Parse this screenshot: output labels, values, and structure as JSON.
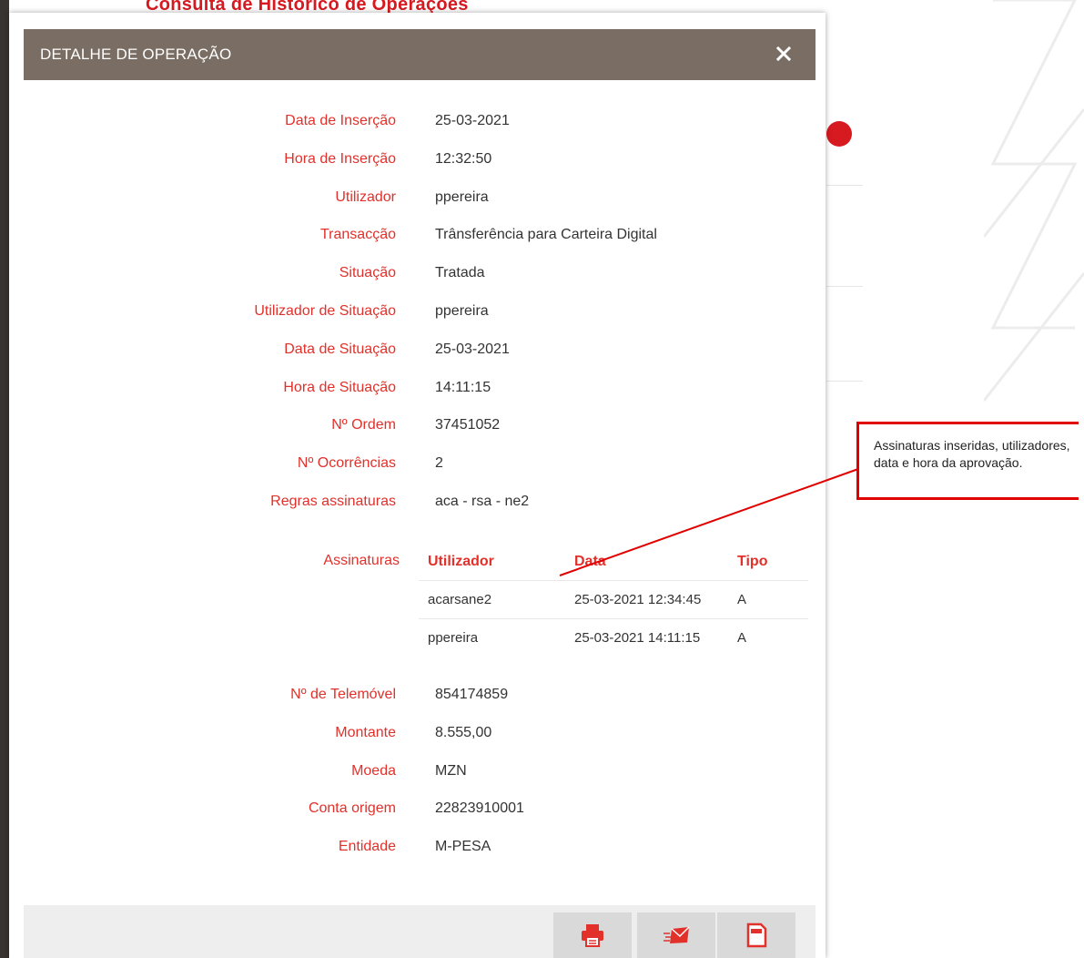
{
  "background": {
    "title": "Consulta de Histórico de Operações",
    "accent": "#d71920"
  },
  "modal": {
    "title": "DETALHE DE OPERAÇÃO",
    "close_icon": "close-icon"
  },
  "fields": [
    {
      "label": "Data de Inserção",
      "value": "25-03-2021"
    },
    {
      "label": "Hora de Inserção",
      "value": "12:32:50"
    },
    {
      "label": "Utilizador",
      "value": "ppereira"
    },
    {
      "label": "Transacção",
      "value": "Trânsferência para Carteira Digital"
    },
    {
      "label": "Situação",
      "value": "Tratada"
    },
    {
      "label": "Utilizador de Situação",
      "value": "ppereira"
    },
    {
      "label": "Data de Situação",
      "value": "25-03-2021"
    },
    {
      "label": "Hora de Situação",
      "value": "14:11:15"
    },
    {
      "label": "Nº Ordem",
      "value": "37451052"
    },
    {
      "label": "Nº Ocorrências",
      "value": "2"
    },
    {
      "label": "Regras assinaturas",
      "value": "aca - rsa - ne2"
    }
  ],
  "signatures": {
    "label": "Assinaturas",
    "headers": [
      "Utilizador",
      "Data",
      "Tipo"
    ],
    "rows": [
      [
        "acarsane2",
        "25-03-2021 12:34:45",
        "A"
      ],
      [
        "ppereira",
        "25-03-2021 14:11:15",
        "A"
      ]
    ]
  },
  "fields2": [
    {
      "label": "Nº de Telemóvel",
      "value": "854174859"
    },
    {
      "label": "Montante",
      "value": "8.555,00"
    },
    {
      "label": "Moeda",
      "value": "MZN"
    },
    {
      "label": "Conta origem",
      "value": "22823910001"
    },
    {
      "label": "Entidade",
      "value": "M-PESA"
    }
  ],
  "footer": {
    "buttons": [
      "print-icon",
      "send-email-icon",
      "pdf-document-icon"
    ]
  },
  "callout": {
    "text": "Assinaturas inseridas, utilizadores, data e hora da aprovação.",
    "color": "#e00000"
  }
}
